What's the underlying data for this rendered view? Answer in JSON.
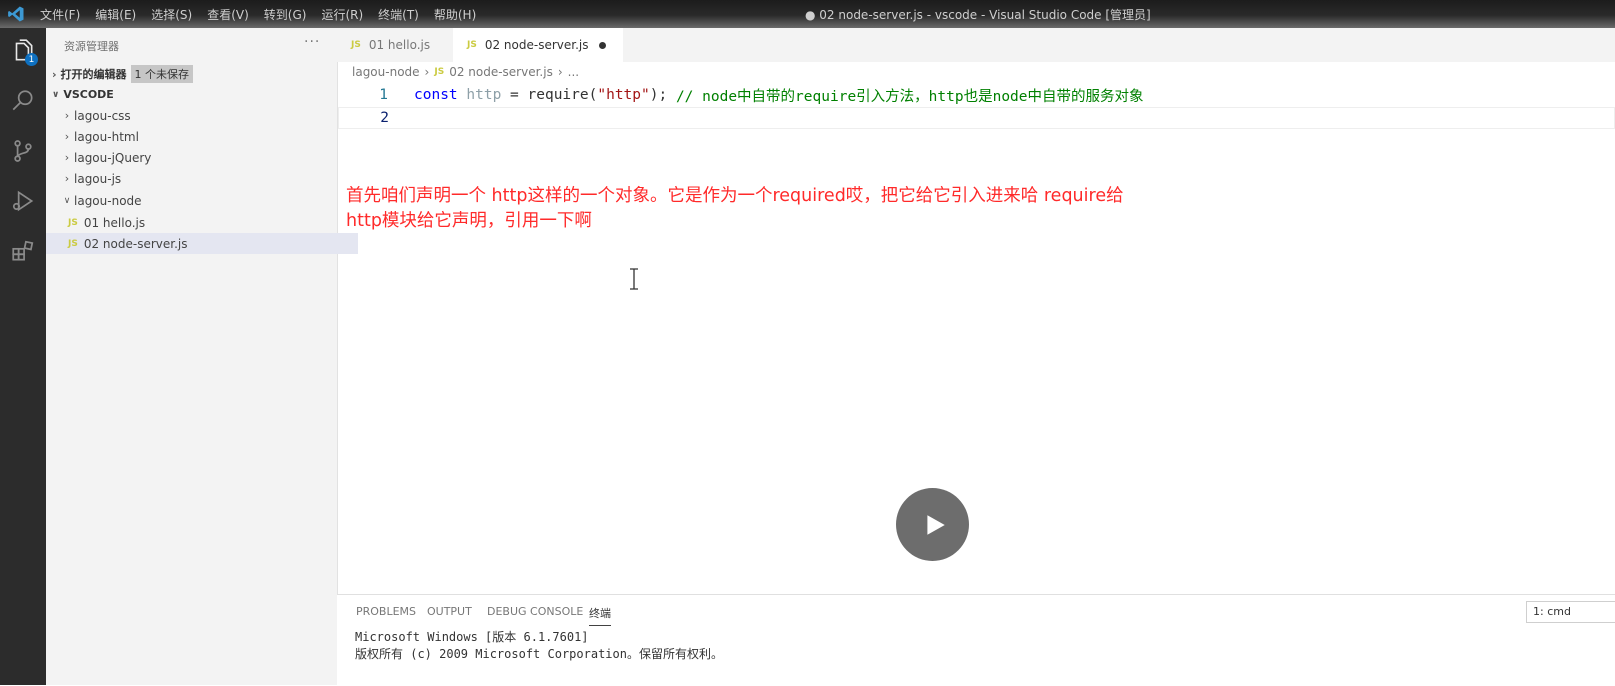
{
  "titlebar": {
    "menus": [
      "文件(F)",
      "编辑(E)",
      "选择(S)",
      "查看(V)",
      "转到(G)",
      "运行(R)",
      "终端(T)",
      "帮助(H)"
    ],
    "window_title": "● 02 node-server.js - vscode - Visual Studio Code [管理员]"
  },
  "activity": {
    "explorer_badge": "1",
    "items": [
      "files-icon",
      "search-icon",
      "source-control-icon",
      "run-debug-icon",
      "extensions-icon"
    ]
  },
  "sidebar": {
    "title": "资源管理器",
    "more": "···",
    "open_editors": {
      "label": "打开的编辑器",
      "badge": "1 个未保存"
    },
    "workspace": "VSCODE",
    "tree": [
      {
        "label": "lagou-css",
        "type": "folder",
        "expanded": false,
        "depth": 0
      },
      {
        "label": "lagou-html",
        "type": "folder",
        "expanded": false,
        "depth": 0
      },
      {
        "label": "lagou-jQuery",
        "type": "folder",
        "expanded": false,
        "depth": 0
      },
      {
        "label": "lagou-js",
        "type": "folder",
        "expanded": false,
        "depth": 0
      },
      {
        "label": "lagou-node",
        "type": "folder",
        "expanded": true,
        "depth": 0
      },
      {
        "label": "01 hello.js",
        "type": "file",
        "depth": 1
      },
      {
        "label": "02 node-server.js",
        "type": "file",
        "depth": 1,
        "selected": true
      }
    ],
    "js_mark": "JS"
  },
  "tabs": [
    {
      "label": "01 hello.js",
      "active": false
    },
    {
      "label": "02 node-server.js",
      "active": true,
      "dirty": true
    }
  ],
  "breadcrumb": {
    "folder": "lagou-node",
    "file": "02 node-server.js",
    "tail": "..."
  },
  "editor": {
    "line1": {
      "num": "1",
      "kw": "const",
      "var": "http",
      "eq": "=",
      "fn": "require",
      "open": "(",
      "str": "\"http\"",
      "close": ");",
      "comment": "// node中自带的require引入方法，http也是node中自带的服务对象"
    },
    "line2": {
      "num": "2"
    }
  },
  "caption": {
    "line1": "首先咱们声明一个  http这样的一个对象。它是作为一个required哎，把它给它引入进来哈  require给",
    "line2": "http模块给它声明，引用一下啊"
  },
  "panel": {
    "tabs": [
      "PROBLEMS",
      "OUTPUT",
      "DEBUG CONSOLE",
      "终端"
    ],
    "active_tab": "终端",
    "terminal_select": "1: cmd",
    "terminal_lines": [
      "Microsoft Windows [版本 6.1.7601]",
      "版权所有 (c) 2009 Microsoft Corporation。保留所有权利。"
    ]
  },
  "colors": {
    "caption": "#ff2a2a",
    "keyword": "#0000ff",
    "string": "#a31515",
    "comment": "#008000",
    "activity_bg": "#2c2c2c",
    "sidebar_bg": "#f3f3f3"
  }
}
